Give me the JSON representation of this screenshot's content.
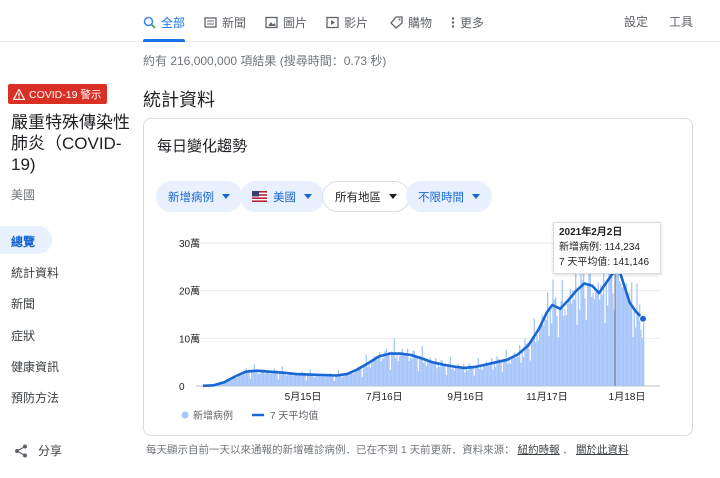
{
  "tabs": [
    {
      "label": "全部",
      "icon": "search-icon"
    },
    {
      "label": "新聞",
      "icon": "newspaper-icon"
    },
    {
      "label": "圖片",
      "icon": "image-icon"
    },
    {
      "label": "影片",
      "icon": "play-icon"
    },
    {
      "label": "購物",
      "icon": "tag-icon"
    },
    {
      "label": "更多",
      "icon": "more-vert-icon"
    }
  ],
  "settings_label": "設定",
  "tools_label": "工具",
  "result_stats": "約有 216,000,000 項結果 (搜尋時間：0.73 秒)",
  "alert_label": "COVID-19 警示",
  "topic": {
    "title": "嚴重特殊傳染性肺炎（COVID-19)",
    "region": "美國"
  },
  "side_nav": [
    "總覽",
    "統計資料",
    "新聞",
    "症狀",
    "健康資訊",
    "預防方法"
  ],
  "share_label": "分享",
  "section_title": "統計資料",
  "card_title": "每日變化趨勢",
  "filters": {
    "metric": "新增病例",
    "country": "美國",
    "area": "所有地區",
    "time": "不限時間"
  },
  "tooltip": {
    "date": "2021年2月2日",
    "cases_line": "新增病例: 114,234",
    "avg_line": "7 天平均值: 141,146"
  },
  "legend": {
    "bars": "新增病例",
    "line": "7 天平均值"
  },
  "footer": {
    "text": "每天顯示自前一天以來通報的新增確診病例．已在不到 1 天前更新．資料來源：",
    "link1": "紐約時報",
    "link2": "關於此資料"
  },
  "colors": {
    "accent": "#1a73e8",
    "bars": "#a8c7fa",
    "line": "#1967d2",
    "alert": "#d93025"
  },
  "chart_data": {
    "type": "bar",
    "yticks": [
      "0",
      "10萬",
      "20萬",
      "30萬"
    ],
    "ylim": [
      0,
      300000
    ],
    "xticks": [
      "5月15日",
      "7月16日",
      "9月16日",
      "11月17日",
      "1月18日"
    ],
    "x_range": [
      "2020-03-01",
      "2021-02-02"
    ],
    "series": [
      {
        "name": "新增病例",
        "kind": "bar"
      },
      {
        "name": "7 天平均值",
        "kind": "line"
      }
    ],
    "average_points": [
      [
        0,
        500
      ],
      [
        8,
        1500
      ],
      [
        16,
        8000
      ],
      [
        24,
        20000
      ],
      [
        32,
        30000
      ],
      [
        40,
        32000
      ],
      [
        50,
        30000
      ],
      [
        60,
        28000
      ],
      [
        70,
        25000
      ],
      [
        80,
        24000
      ],
      [
        90,
        23000
      ],
      [
        100,
        22000
      ],
      [
        108,
        25000
      ],
      [
        116,
        35000
      ],
      [
        124,
        48000
      ],
      [
        132,
        62000
      ],
      [
        140,
        68000
      ],
      [
        148,
        68000
      ],
      [
        156,
        65000
      ],
      [
        164,
        58000
      ],
      [
        172,
        50000
      ],
      [
        180,
        45000
      ],
      [
        188,
        41000
      ],
      [
        196,
        38000
      ],
      [
        204,
        40000
      ],
      [
        212,
        45000
      ],
      [
        220,
        50000
      ],
      [
        228,
        55000
      ],
      [
        236,
        66000
      ],
      [
        244,
        85000
      ],
      [
        252,
        120000
      ],
      [
        258,
        155000
      ],
      [
        262,
        170000
      ],
      [
        268,
        162000
      ],
      [
        274,
        180000
      ],
      [
        280,
        200000
      ],
      [
        286,
        215000
      ],
      [
        292,
        210000
      ],
      [
        297,
        195000
      ],
      [
        302,
        215000
      ],
      [
        307,
        235000
      ],
      [
        312,
        245000
      ],
      [
        316,
        210000
      ],
      [
        320,
        175000
      ],
      [
        325,
        155000
      ],
      [
        330,
        141146
      ]
    ]
  }
}
